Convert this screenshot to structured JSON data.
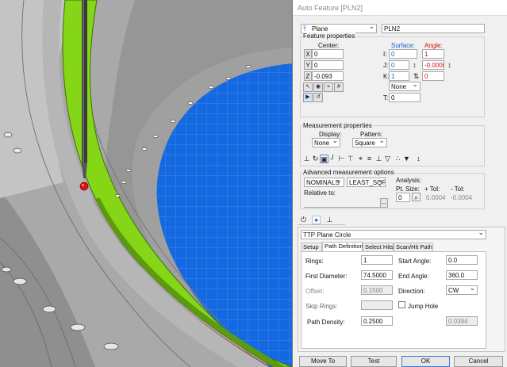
{
  "window": {
    "title": "Auto Feature [PLN2]"
  },
  "feature": {
    "type": "Plane",
    "type_icon": "plane-arrow-icon",
    "name": "PLN2"
  },
  "properties": {
    "title": "Feature properties",
    "center_label": "Center:",
    "surface_label": "Surface:",
    "angle_label": "Angle:",
    "x_label": "X",
    "y_label": "Y",
    "z_label": "Z",
    "i_label": "I:",
    "j_label": "J:",
    "k_label": "K:",
    "t_label": "T:",
    "x": "0",
    "y": "0",
    "z": "-0.093",
    "surface_i": "0",
    "surface_j": "0",
    "surface_k": "1",
    "angle_i": "1",
    "angle_j": "-0.0000",
    "angle_k": "0",
    "none_select": "None",
    "t_value": "0"
  },
  "measurement": {
    "title": "Measurement properties",
    "display_label": "Display:",
    "pattern_label": "Pattern:",
    "display": "None",
    "pattern": "Square"
  },
  "advanced": {
    "title": "Advanced measurement options",
    "nominals": "NOMINALS",
    "fit": "LEAST_SQR",
    "relative_to": "Relative to:",
    "analysis": "Analysis:",
    "pt_size": "Pt. Size:",
    "pt_size_value": "0",
    "plus_tol": "+ Tol:",
    "plus_tol_value": "0.0004",
    "minus_tol": "- Tol:",
    "minus_tol_value": "-0.0004",
    "browse": "..."
  },
  "strategy": {
    "select": "TTP Plane Circle",
    "tabs": [
      "Setup",
      "Path Definition",
      "Select Hits",
      "Scan/Hit Path"
    ],
    "active_tab": 1,
    "rings_label": "Rings:",
    "rings": "1",
    "start_angle_label": "Start Angle:",
    "start_angle": "0.0",
    "first_diameter_label": "First Diameter:",
    "first_diameter": "74.5000",
    "end_angle_label": "End Angle:",
    "end_angle": "360.0",
    "offset_label": "Offset:",
    "offset": "0.1500",
    "direction_label": "Direction:",
    "direction": "CW",
    "skip_rings_label": "Skip Rings:",
    "jump_hole_label": "Jump Hole",
    "path_density_label": "Path Density:",
    "path_density": "0.2500",
    "computed_value": "0.0394"
  },
  "buttons": {
    "move_to": "Move To",
    "test": "Test",
    "ok": "OK",
    "cancel": "Cancel"
  },
  "colors": {
    "accent_green": "#8ada1a",
    "grid_blue": "#1b6fe0",
    "angle_red": "#d01010",
    "surface_blue": "#1a5fd0"
  }
}
